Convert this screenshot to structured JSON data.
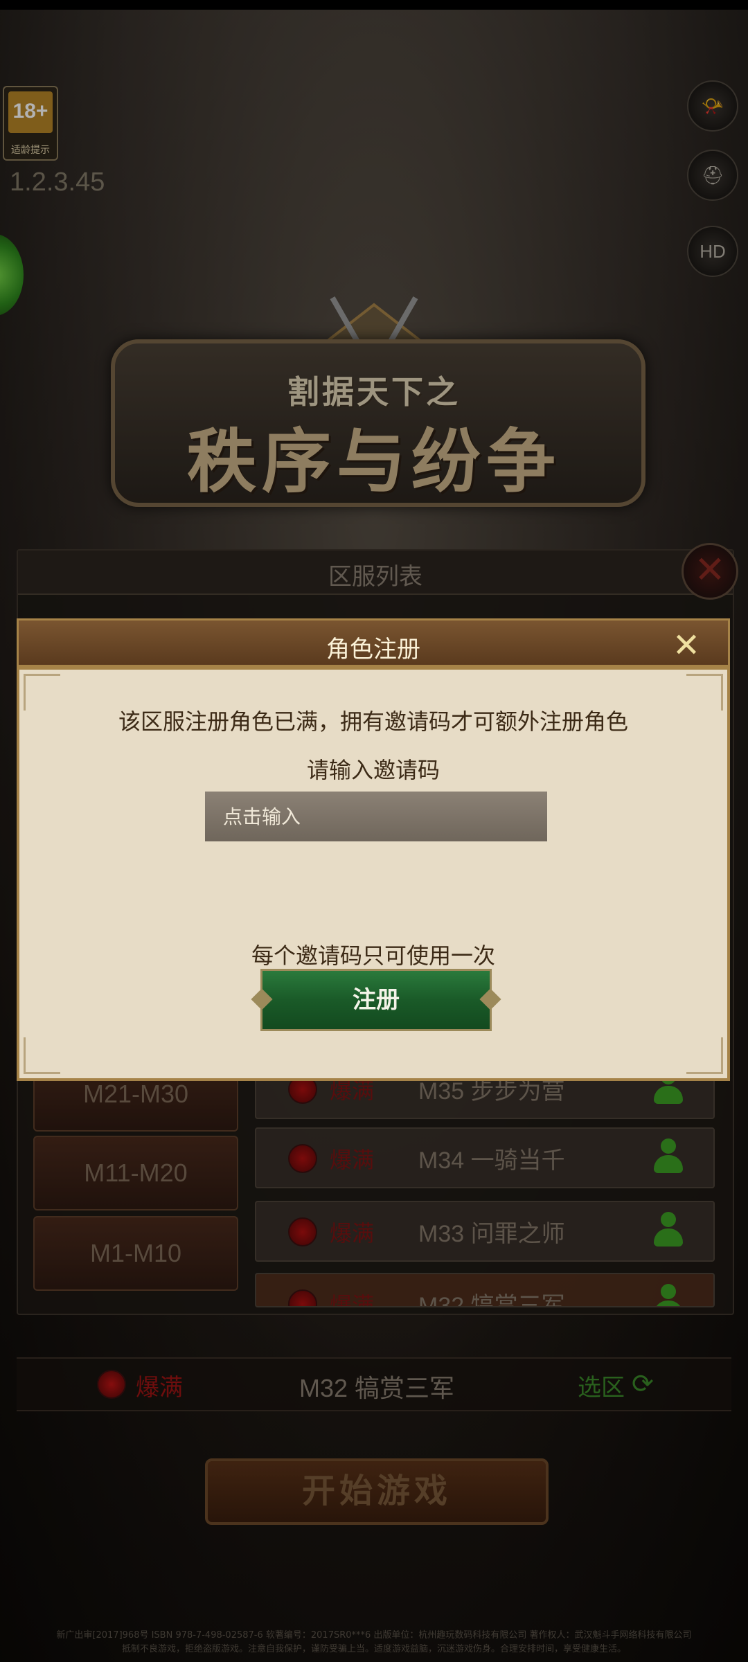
{
  "age_badge": {
    "rating": "18+",
    "label": "适龄提示"
  },
  "version": "1.2.3.45",
  "side_icons": [
    {
      "name": "horn-icon",
      "glyph": "📯"
    },
    {
      "name": "helmet-icon",
      "glyph": "⛑"
    },
    {
      "name": "hd-icon",
      "glyph": "HD"
    }
  ],
  "logo": {
    "subtitle": "割据天下之",
    "title": "秩序与纷争"
  },
  "server_panel": {
    "title": "区服列表",
    "ranges": [
      "M21-M30",
      "M11-M20",
      "M1-M10"
    ],
    "servers": [
      {
        "status": "爆满",
        "name": "M35 步步为营"
      },
      {
        "status": "爆满",
        "name": "M34 一骑当千"
      },
      {
        "status": "爆满",
        "name": "M33 问罪之师"
      },
      {
        "status": "爆满",
        "name": "M32 犒赏三军"
      }
    ]
  },
  "dialog": {
    "title": "角色注册",
    "close_glyph": "✕",
    "message": "该区服注册角色已满，拥有邀请码才可额外注册角色",
    "prompt": "请输入邀请码",
    "input_placeholder": "点击输入",
    "input_value": "",
    "note": "每个邀请码只可使用一次",
    "register_label": "注册"
  },
  "current_server": {
    "status": "爆满",
    "name": "M32 犒赏三军",
    "select_label": "选区",
    "refresh_glyph": "⟳"
  },
  "start_button": "开始游戏",
  "legal": {
    "line1": "新广出审[2017]968号 ISBN 978-7-498-02587-6 软著编号：2017SR0***6 出版单位：杭州趣玩数码科技有限公司 著作权人：武汉魁斗手网络科技有限公司",
    "line2": "抵制不良游戏，拒绝盗版游戏。注意自我保护，谨防受骗上当。适度游戏益脑，沉迷游戏伤身。合理安排时间，享受健康生活。"
  },
  "colors": {
    "accent_gold": "#a68348",
    "dialog_bg": "#e7dcc6",
    "register_green": "#1a5a28",
    "full_red": "#9e1414",
    "online_green": "#3da025"
  }
}
